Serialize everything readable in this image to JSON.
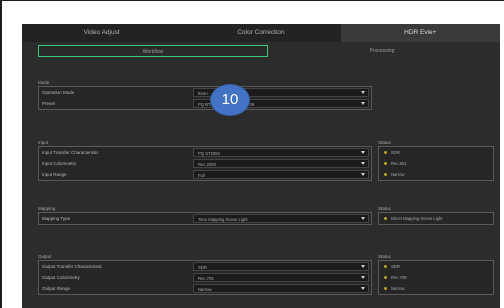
{
  "tabs": [
    {
      "label": "Video Adjust"
    },
    {
      "label": "Color Correction"
    },
    {
      "label": "HDR Evie+"
    }
  ],
  "subtabs": [
    {
      "label": "Workflow"
    },
    {
      "label": "Processing"
    }
  ],
  "badge": {
    "text": "10"
  },
  "mode": {
    "title": "Mode",
    "rows": [
      {
        "label": "Operation Mode",
        "value": "Evie+"
      },
      {
        "label": "Preset",
        "value": "PQ BT.2020 1000 -> SDR 709"
      }
    ]
  },
  "input": {
    "title": "Input",
    "status_title": "Status",
    "rows": [
      {
        "label": "Input Transfer Characteristic",
        "value": "PQ ST2084"
      },
      {
        "label": "Input Colorimetry",
        "value": "Rec.2020"
      },
      {
        "label": "Input Range",
        "value": "Full"
      }
    ],
    "status": [
      {
        "text": "SDR"
      },
      {
        "text": "Rec.601"
      },
      {
        "text": "Narrow"
      }
    ]
  },
  "mapping": {
    "title": "Mapping",
    "status_title": "Status",
    "rows": [
      {
        "label": "Mapping Type",
        "value": "Tone Mapping Scene Light"
      }
    ],
    "status": [
      {
        "text": "Direct Mapping Scene Light"
      }
    ]
  },
  "output": {
    "title": "Output",
    "status_title": "Status",
    "rows": [
      {
        "label": "Output Transfer Characteristic",
        "value": "SDR"
      },
      {
        "label": "Output Colorimetry",
        "value": "Rec.709"
      },
      {
        "label": "Output Range",
        "value": "Narrow"
      }
    ],
    "status": [
      {
        "text": "SDR"
      },
      {
        "text": "Rec.709"
      },
      {
        "text": "Narrow"
      }
    ]
  },
  "colors": {
    "active_subtab_border": "#3ec97a",
    "badge_fill": "#4472c4",
    "status_dot": "#b9a025"
  }
}
